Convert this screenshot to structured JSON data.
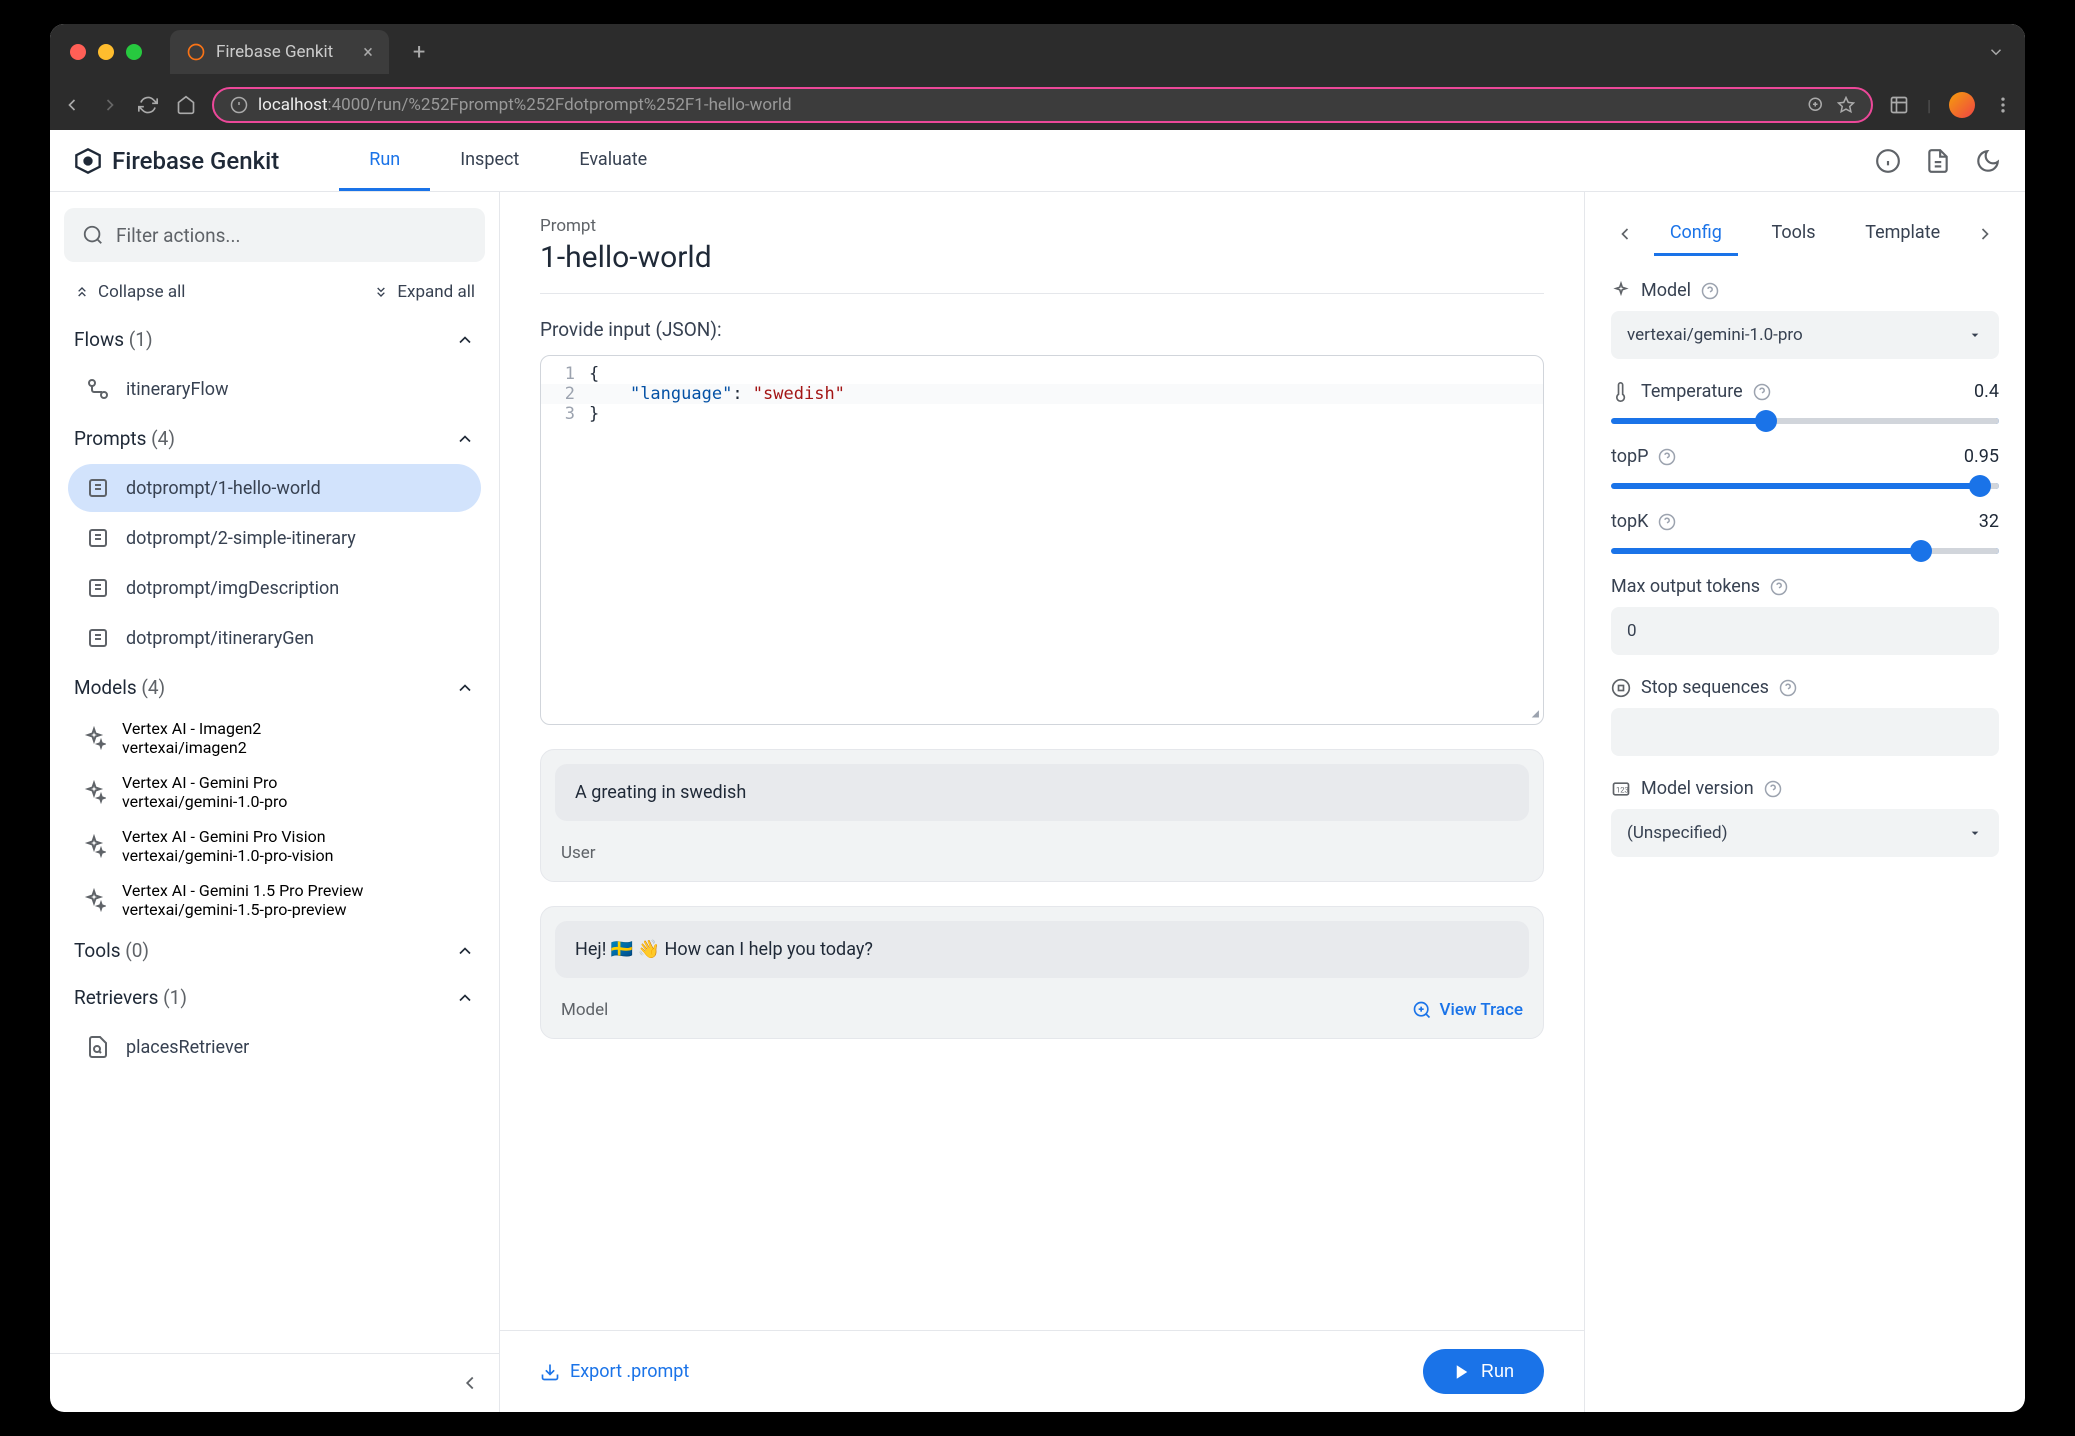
{
  "browser": {
    "tab_title": "Firebase Genkit",
    "url_host": "localhost",
    "url_port": ":4000",
    "url_path": "/run/%252Fprompt%252Fdotprompt%252F1-hello-world"
  },
  "header": {
    "app_name": "Firebase Genkit",
    "tabs": [
      "Run",
      "Inspect",
      "Evaluate"
    ]
  },
  "sidebar": {
    "search_placeholder": "Filter actions...",
    "collapse_all": "Collapse all",
    "expand_all": "Expand all",
    "sections": {
      "flows": {
        "title": "Flows",
        "count": "(1)",
        "items": [
          "itineraryFlow"
        ]
      },
      "prompts": {
        "title": "Prompts",
        "count": "(4)",
        "items": [
          "dotprompt/1-hello-world",
          "dotprompt/2-simple-itinerary",
          "dotprompt/imgDescription",
          "dotprompt/itineraryGen"
        ]
      },
      "models": {
        "title": "Models",
        "count": "(4)",
        "items": [
          {
            "title": "Vertex AI - Imagen2",
            "sub": "vertexai/imagen2"
          },
          {
            "title": "Vertex AI - Gemini Pro",
            "sub": "vertexai/gemini-1.0-pro"
          },
          {
            "title": "Vertex AI - Gemini Pro Vision",
            "sub": "vertexai/gemini-1.0-pro-vision"
          },
          {
            "title": "Vertex AI - Gemini 1.5 Pro Preview",
            "sub": "vertexai/gemini-1.5-pro-preview"
          }
        ]
      },
      "tools": {
        "title": "Tools",
        "count": "(0)"
      },
      "retrievers": {
        "title": "Retrievers",
        "count": "(1)",
        "items": [
          "placesRetriever"
        ]
      }
    }
  },
  "main": {
    "label": "Prompt",
    "title": "1-hello-world",
    "input_label": "Provide input (JSON):",
    "code_lines": [
      "1",
      "2",
      "3"
    ],
    "json_input": {
      "key": "\"language\"",
      "value": "\"swedish\""
    },
    "msg1": {
      "text": "A greating in swedish",
      "role": "User"
    },
    "msg2": {
      "text": "Hej! 🇸🇪 👋 How can I help you today?",
      "role": "Model",
      "view_trace": "View Trace"
    },
    "export": "Export .prompt",
    "run": "Run"
  },
  "rpanel": {
    "tabs": [
      "Config",
      "Tools",
      "Template"
    ],
    "model_label": "Model",
    "model_value": "vertexai/gemini-1.0-pro",
    "temp_label": "Temperature",
    "temp_value": "0.4",
    "topp_label": "topP",
    "topp_value": "0.95",
    "topk_label": "topK",
    "topk_value": "32",
    "max_tokens_label": "Max output tokens",
    "max_tokens_value": "0",
    "stop_label": "Stop sequences",
    "version_label": "Model version",
    "version_value": "(Unspecified)"
  }
}
